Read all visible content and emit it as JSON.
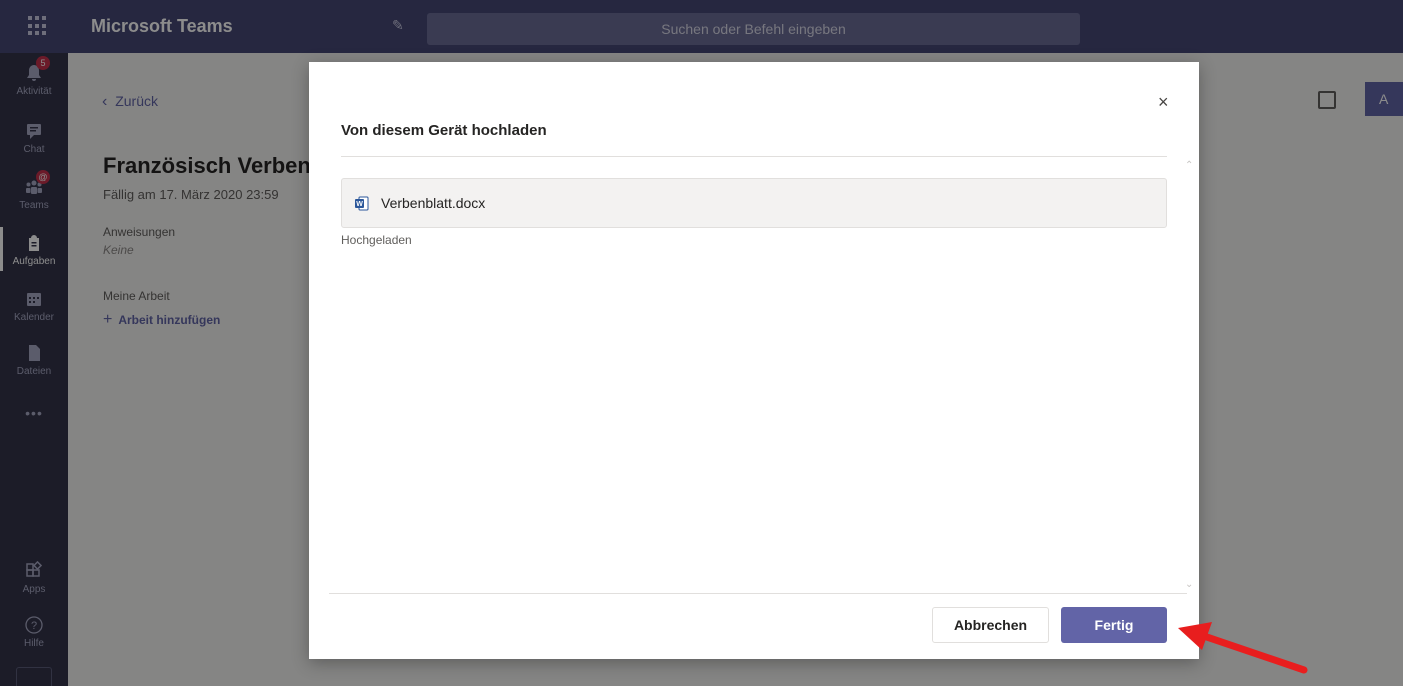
{
  "topbar": {
    "app_title": "Microsoft Teams",
    "search_placeholder": "Suchen oder Befehl eingeben"
  },
  "rail": {
    "items": [
      {
        "label": "Aktivität",
        "icon": "bell-icon",
        "badge": "5"
      },
      {
        "label": "Chat",
        "icon": "chat-icon"
      },
      {
        "label": "Teams",
        "icon": "teams-icon",
        "badge": "@"
      },
      {
        "label": "Aufgaben",
        "icon": "assignments-icon"
      },
      {
        "label": "Kalender",
        "icon": "calendar-icon"
      },
      {
        "label": "Dateien",
        "icon": "files-icon"
      },
      {
        "label": "•••",
        "icon": "more-icon"
      },
      {
        "label": "Apps",
        "icon": "apps-icon"
      },
      {
        "label": "Hilfe",
        "icon": "help-icon"
      }
    ]
  },
  "assignment": {
    "back_label": "Zurück",
    "title": "Französisch Verben",
    "due": "Fällig am 17. März 2020 23:59",
    "instructions_label": "Anweisungen",
    "instructions_value": "Keine",
    "my_work_label": "Meine Arbeit",
    "add_work_label": "Arbeit hinzufügen",
    "top_button_label": "A"
  },
  "dialog": {
    "title": "Von diesem Gerät hochladen",
    "close_glyph": "×",
    "file_name": "Verbenblatt.docx",
    "file_status": "Hochgeladen",
    "cancel_label": "Abbrechen",
    "done_label": "Fertig"
  },
  "colors": {
    "accent": "#6264a7",
    "topbar": "#464775",
    "rail": "#33344a",
    "arrow": "#e81e1e"
  }
}
